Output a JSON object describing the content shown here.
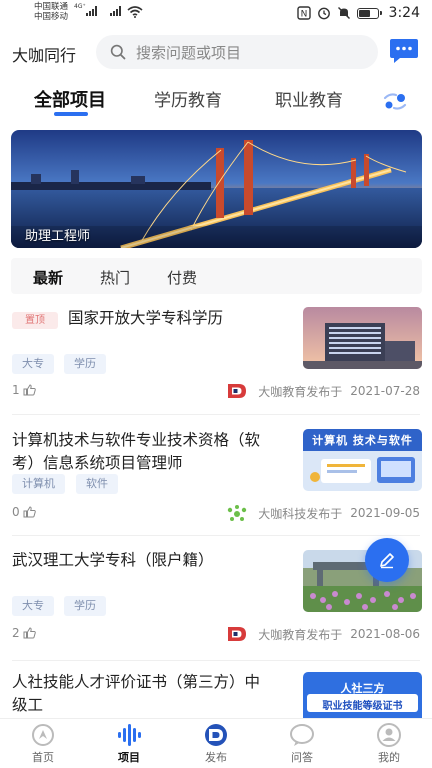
{
  "status_bar": {
    "carrier_1": "中国联通",
    "carrier_2": "中国移动",
    "network": "4G⁺",
    "time": "3:24",
    "battery_level": 0.7
  },
  "header": {
    "brand": "大咖同行",
    "search_placeholder": "搜索问题或项目",
    "chat_icon": "chat-bubble-icon"
  },
  "category_tabs": [
    {
      "label": "全部项目",
      "active": true
    },
    {
      "label": "学历教育",
      "active": false
    },
    {
      "label": "职业教育",
      "active": false
    }
  ],
  "banner": {
    "caption": "助理工程师"
  },
  "feed_tabs": [
    {
      "label": "最新",
      "active": true
    },
    {
      "label": "热门",
      "active": false
    },
    {
      "label": "付费",
      "active": false
    }
  ],
  "feed": [
    {
      "badge": "置顶",
      "title": "国家开放大学专科学历",
      "tags": [
        "大专",
        "学历"
      ],
      "likes": "1",
      "publisher": "大咖教育发布于",
      "date": "2021-07-28"
    },
    {
      "title_line1": "计算机技术与软件专业技术资格（软",
      "title_line2": "考）信息系统项目管理师",
      "tags": [
        "计算机",
        "软件"
      ],
      "likes": "0",
      "publisher": "大咖科技发布于",
      "date": "2021-09-05",
      "image_text": "计算机 技术与软件"
    },
    {
      "title": "武汉理工大学专科（限户籍）",
      "tags": [
        "大专",
        "学历"
      ],
      "likes": "2",
      "publisher": "大咖教育发布于",
      "date": "2021-08-06"
    },
    {
      "title_line1": "人社技能人才评价证书（第三方）中",
      "title_line2": "级工",
      "image_text_1": "人社三方",
      "image_text_2": "职业技能等级证书"
    }
  ],
  "bottom_nav": [
    {
      "label": "首页",
      "active": false,
      "icon": "home-icon"
    },
    {
      "label": "项目",
      "active": true,
      "icon": "project-icon"
    },
    {
      "label": "发布",
      "active": false,
      "icon": "publish-icon"
    },
    {
      "label": "问答",
      "active": false,
      "icon": "qa-icon"
    },
    {
      "label": "我的",
      "active": false,
      "icon": "profile-icon"
    }
  ],
  "colors": {
    "accent": "#2b6ff0",
    "badge_bg": "#fbeaea",
    "badge_text": "#e07575",
    "tag_bg": "#eef3fb"
  }
}
